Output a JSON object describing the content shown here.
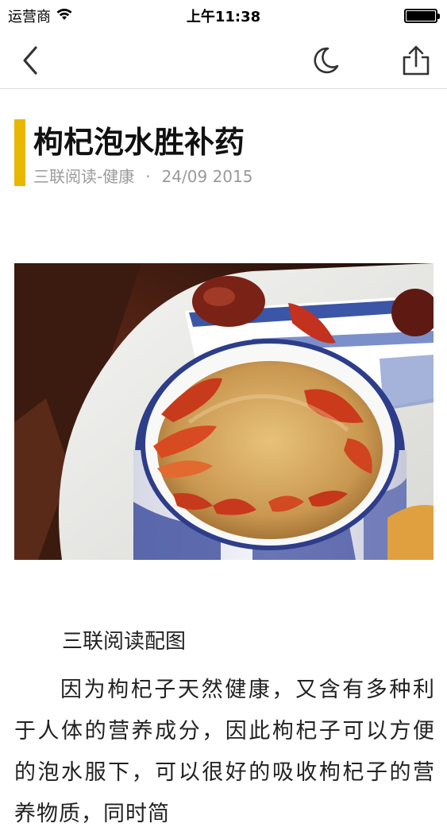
{
  "status_bar": {
    "carrier": "运营商",
    "time": "上午11:38",
    "battery_level": 1.0
  },
  "nav": {
    "back_icon": "chevron-left-icon",
    "night_icon": "moon-icon",
    "share_icon": "share-icon"
  },
  "article": {
    "title": "枸杞泡水胜补药",
    "source": "三联阅读-健康",
    "separator": "·",
    "date": "24/09 2015",
    "caption": "三联阅读配图",
    "body": "因为枸杞子天然健康，又含有多种利于人体的营养成分，因此枸杞子可以方便的泡水服下，可以很好的吸收枸杞子的营养物质，同时简"
  },
  "colors": {
    "accent": "#e8b800",
    "meta_text": "#9a9a9a",
    "divider": "#dcdcdc"
  }
}
